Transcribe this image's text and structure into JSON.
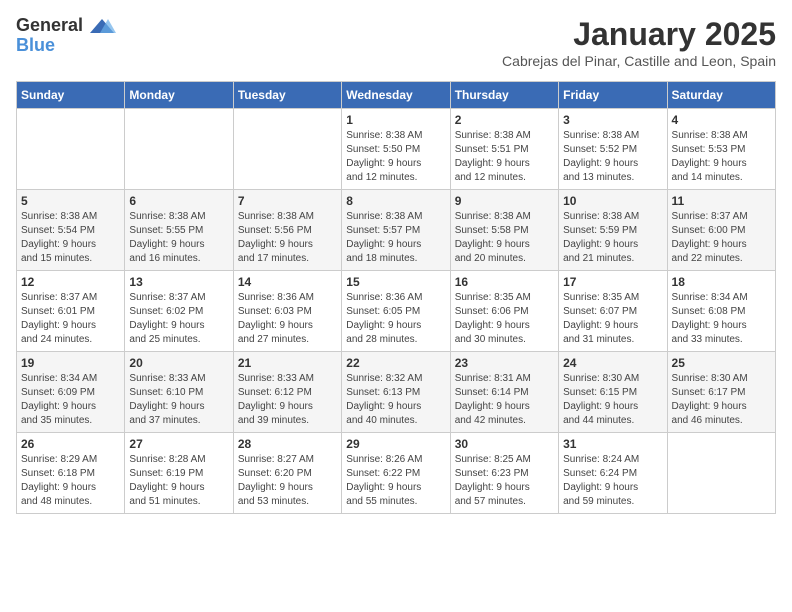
{
  "header": {
    "logo_general": "General",
    "logo_blue": "Blue",
    "month": "January 2025",
    "location": "Cabrejas del Pinar, Castille and Leon, Spain"
  },
  "weekdays": [
    "Sunday",
    "Monday",
    "Tuesday",
    "Wednesday",
    "Thursday",
    "Friday",
    "Saturday"
  ],
  "weeks": [
    [
      {
        "day": "",
        "info": ""
      },
      {
        "day": "",
        "info": ""
      },
      {
        "day": "",
        "info": ""
      },
      {
        "day": "1",
        "info": "Sunrise: 8:38 AM\nSunset: 5:50 PM\nDaylight: 9 hours\nand 12 minutes."
      },
      {
        "day": "2",
        "info": "Sunrise: 8:38 AM\nSunset: 5:51 PM\nDaylight: 9 hours\nand 12 minutes."
      },
      {
        "day": "3",
        "info": "Sunrise: 8:38 AM\nSunset: 5:52 PM\nDaylight: 9 hours\nand 13 minutes."
      },
      {
        "day": "4",
        "info": "Sunrise: 8:38 AM\nSunset: 5:53 PM\nDaylight: 9 hours\nand 14 minutes."
      }
    ],
    [
      {
        "day": "5",
        "info": "Sunrise: 8:38 AM\nSunset: 5:54 PM\nDaylight: 9 hours\nand 15 minutes."
      },
      {
        "day": "6",
        "info": "Sunrise: 8:38 AM\nSunset: 5:55 PM\nDaylight: 9 hours\nand 16 minutes."
      },
      {
        "day": "7",
        "info": "Sunrise: 8:38 AM\nSunset: 5:56 PM\nDaylight: 9 hours\nand 17 minutes."
      },
      {
        "day": "8",
        "info": "Sunrise: 8:38 AM\nSunset: 5:57 PM\nDaylight: 9 hours\nand 18 minutes."
      },
      {
        "day": "9",
        "info": "Sunrise: 8:38 AM\nSunset: 5:58 PM\nDaylight: 9 hours\nand 20 minutes."
      },
      {
        "day": "10",
        "info": "Sunrise: 8:38 AM\nSunset: 5:59 PM\nDaylight: 9 hours\nand 21 minutes."
      },
      {
        "day": "11",
        "info": "Sunrise: 8:37 AM\nSunset: 6:00 PM\nDaylight: 9 hours\nand 22 minutes."
      }
    ],
    [
      {
        "day": "12",
        "info": "Sunrise: 8:37 AM\nSunset: 6:01 PM\nDaylight: 9 hours\nand 24 minutes."
      },
      {
        "day": "13",
        "info": "Sunrise: 8:37 AM\nSunset: 6:02 PM\nDaylight: 9 hours\nand 25 minutes."
      },
      {
        "day": "14",
        "info": "Sunrise: 8:36 AM\nSunset: 6:03 PM\nDaylight: 9 hours\nand 27 minutes."
      },
      {
        "day": "15",
        "info": "Sunrise: 8:36 AM\nSunset: 6:05 PM\nDaylight: 9 hours\nand 28 minutes."
      },
      {
        "day": "16",
        "info": "Sunrise: 8:35 AM\nSunset: 6:06 PM\nDaylight: 9 hours\nand 30 minutes."
      },
      {
        "day": "17",
        "info": "Sunrise: 8:35 AM\nSunset: 6:07 PM\nDaylight: 9 hours\nand 31 minutes."
      },
      {
        "day": "18",
        "info": "Sunrise: 8:34 AM\nSunset: 6:08 PM\nDaylight: 9 hours\nand 33 minutes."
      }
    ],
    [
      {
        "day": "19",
        "info": "Sunrise: 8:34 AM\nSunset: 6:09 PM\nDaylight: 9 hours\nand 35 minutes."
      },
      {
        "day": "20",
        "info": "Sunrise: 8:33 AM\nSunset: 6:10 PM\nDaylight: 9 hours\nand 37 minutes."
      },
      {
        "day": "21",
        "info": "Sunrise: 8:33 AM\nSunset: 6:12 PM\nDaylight: 9 hours\nand 39 minutes."
      },
      {
        "day": "22",
        "info": "Sunrise: 8:32 AM\nSunset: 6:13 PM\nDaylight: 9 hours\nand 40 minutes."
      },
      {
        "day": "23",
        "info": "Sunrise: 8:31 AM\nSunset: 6:14 PM\nDaylight: 9 hours\nand 42 minutes."
      },
      {
        "day": "24",
        "info": "Sunrise: 8:30 AM\nSunset: 6:15 PM\nDaylight: 9 hours\nand 44 minutes."
      },
      {
        "day": "25",
        "info": "Sunrise: 8:30 AM\nSunset: 6:17 PM\nDaylight: 9 hours\nand 46 minutes."
      }
    ],
    [
      {
        "day": "26",
        "info": "Sunrise: 8:29 AM\nSunset: 6:18 PM\nDaylight: 9 hours\nand 48 minutes."
      },
      {
        "day": "27",
        "info": "Sunrise: 8:28 AM\nSunset: 6:19 PM\nDaylight: 9 hours\nand 51 minutes."
      },
      {
        "day": "28",
        "info": "Sunrise: 8:27 AM\nSunset: 6:20 PM\nDaylight: 9 hours\nand 53 minutes."
      },
      {
        "day": "29",
        "info": "Sunrise: 8:26 AM\nSunset: 6:22 PM\nDaylight: 9 hours\nand 55 minutes."
      },
      {
        "day": "30",
        "info": "Sunrise: 8:25 AM\nSunset: 6:23 PM\nDaylight: 9 hours\nand 57 minutes."
      },
      {
        "day": "31",
        "info": "Sunrise: 8:24 AM\nSunset: 6:24 PM\nDaylight: 9 hours\nand 59 minutes."
      },
      {
        "day": "",
        "info": ""
      }
    ]
  ]
}
